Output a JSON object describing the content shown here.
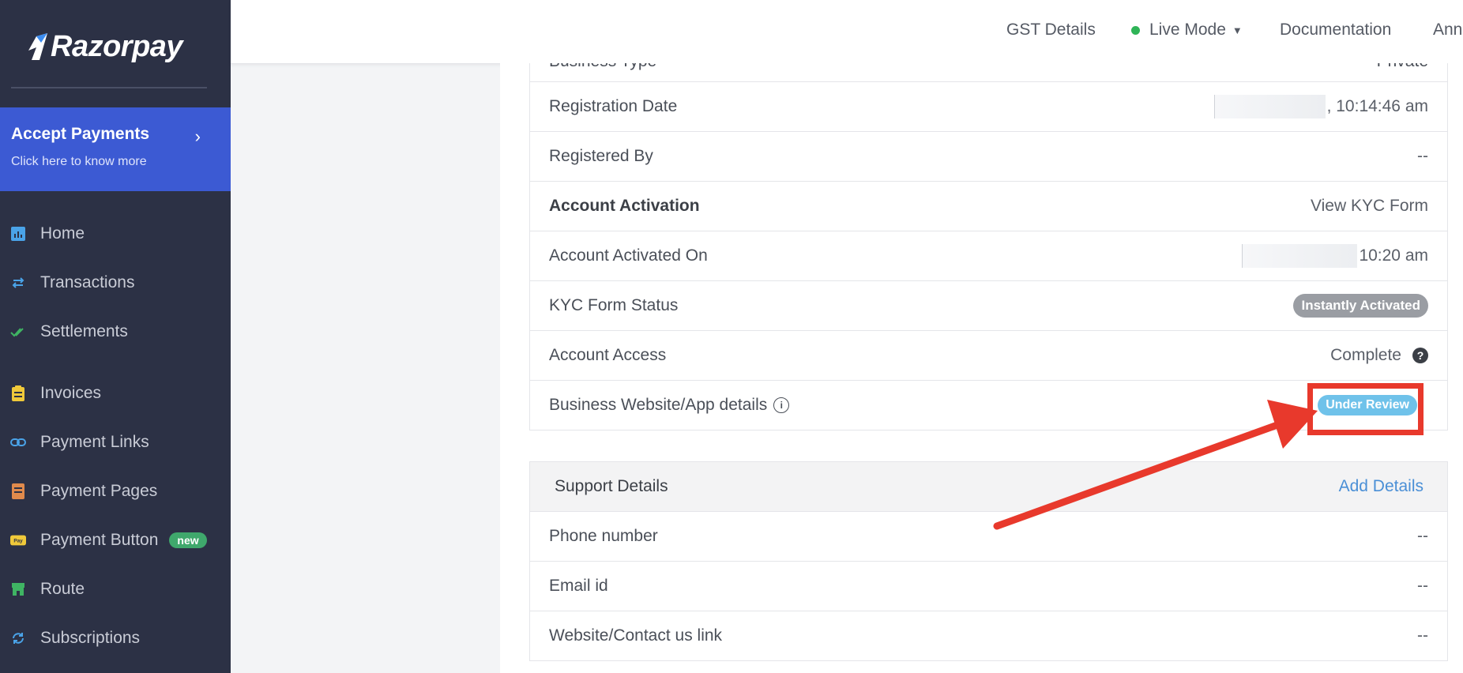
{
  "sidebar": {
    "logo_text": "Razorpay",
    "promo": {
      "title": "Accept Payments",
      "subtitle": "Click here to know more",
      "chevron": "›"
    },
    "items": [
      {
        "label": "Home",
        "icon": "chart-icon"
      },
      {
        "label": "Transactions",
        "icon": "swap-icon"
      },
      {
        "label": "Settlements",
        "icon": "double-check-icon"
      },
      {
        "label": "Invoices",
        "icon": "invoice-icon"
      },
      {
        "label": "Payment Links",
        "icon": "link-icon"
      },
      {
        "label": "Payment Pages",
        "icon": "page-icon"
      },
      {
        "label": "Payment Button",
        "icon": "pay-button-icon",
        "badge": "new"
      },
      {
        "label": "Route",
        "icon": "store-icon"
      },
      {
        "label": "Subscriptions",
        "icon": "refresh-icon"
      }
    ]
  },
  "topbar": {
    "gst": "GST Details",
    "mode": "Live Mode",
    "docs": "Documentation",
    "user_partial": "Ann"
  },
  "details": {
    "business_type_partial": "Business Type",
    "business_type_value_partial": "Private",
    "rows": [
      {
        "label": "Registration Date",
        "value": ", 10:14:46 am"
      },
      {
        "label": "Registered By",
        "value": "--"
      },
      {
        "label": "Account Activation",
        "value": "View KYC Form"
      },
      {
        "label": "Account Activated On",
        "value": "10:20 am"
      },
      {
        "label": "KYC Form Status",
        "value": "Instantly Activated"
      },
      {
        "label": "Account Access",
        "value": "Complete"
      },
      {
        "label": "Business Website/App details",
        "value": "Under Review"
      }
    ]
  },
  "support": {
    "title": "Support Details",
    "action": "Add Details",
    "rows": [
      {
        "label": "Phone number",
        "value": "--"
      },
      {
        "label": "Email id",
        "value": "--"
      },
      {
        "label": "Website/Contact us link",
        "value": "--"
      }
    ]
  },
  "colors": {
    "sidebar_bg": "#2c3145",
    "accent_blue": "#3c5ad3",
    "link": "#4a8fd6",
    "annotation_red": "#e8392c",
    "live_green": "#2fb457"
  }
}
